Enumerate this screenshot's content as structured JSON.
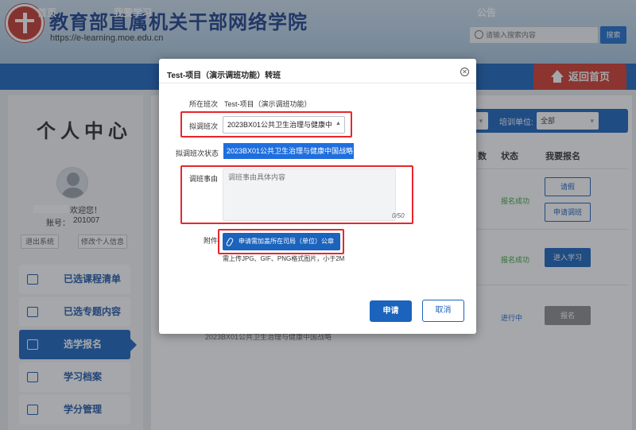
{
  "header": {
    "title": "教育部直属机关干部网络学院",
    "url": "https://e-learning.moe.edu.cn",
    "search_placeholder": "请输入搜索内容",
    "search_button": "搜索"
  },
  "nav": {
    "items": [
      "首页",
      "我要学习",
      "公告"
    ],
    "home_button": "返回首页"
  },
  "sidebar": {
    "title": "个人中心",
    "welcome": "欢迎您！",
    "account_label": "账号：",
    "account_number": "201007",
    "logout": "退出系统",
    "edit_profile": "修改个人信息",
    "menu": [
      "已选课程清单",
      "已选专题内容",
      "选学报名",
      "学习档案",
      "学分管理"
    ],
    "active_index": 2
  },
  "main": {
    "filter_label": "培训单位:",
    "filter_value": "全部",
    "columns": [
      "数",
      "状态",
      "我要报名"
    ],
    "rows": [
      {
        "status": "报名成功",
        "actions": [
          "请假",
          "申请调班"
        ]
      },
      {
        "status": "报名成功",
        "actions": [
          "进入学习"
        ]
      },
      {
        "status": "进行中",
        "actions": [
          "报名"
        ]
      }
    ],
    "under_text": "2023BX01公共卫生治理与健康中国战略"
  },
  "modal": {
    "title": "Test-项目（演示调班功能）转班",
    "current_class_label": "所在班次",
    "current_class_value": "Test-项目（演示调班功能）",
    "target_class_label": "拟调班次",
    "target_class_value": "2023BX01公共卫生治理与健康中",
    "dropdown_option": "2023BX01公共卫生治理与健康中国战略",
    "target_status_label": "拟调班次状态",
    "reason_label": "调班事由",
    "reason_placeholder": "调班事由具体内容",
    "char_count": "0/50",
    "attachment_label": "附件",
    "upload_button": "申请需加盖所在司局（单位）公章",
    "upload_hint": "需上传JPG、GIF、PNG格式图片，小于2M",
    "submit_button": "申请",
    "cancel_button": "取消"
  },
  "colors": {
    "primary_blue": "#1b63bd",
    "red_highlight": "#e8262c",
    "success_green": "#3aa33a",
    "in_progress_blue": "#1b63bd",
    "home_red": "#d23a2e"
  }
}
